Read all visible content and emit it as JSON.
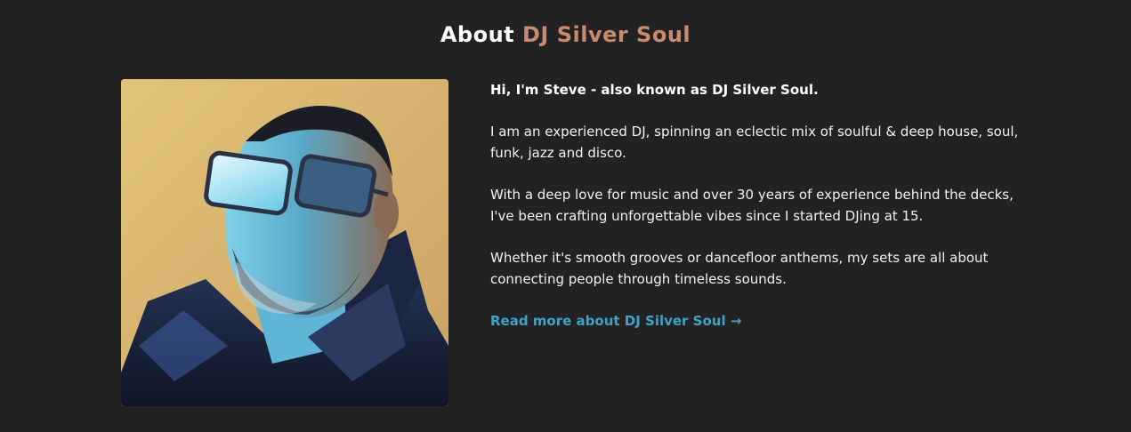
{
  "heading": {
    "prefix": "About",
    "accent": "DJ Silver Soul"
  },
  "photo": {
    "alt": "Portrait of DJ Silver Soul wearing reflective glasses and a leather jacket"
  },
  "about": {
    "intro": "Hi, I'm Steve - also known as DJ Silver Soul.",
    "paragraph_1": "I am an experienced DJ, spinning an eclectic mix of soulful & deep house, soul, funk, jazz and disco.",
    "paragraph_2": "With a deep love for music and over 30 years of experience behind the decks, I've been crafting unforgettable vibes since I started DJing at 15.",
    "paragraph_3": "Whether it's smooth grooves or dancefloor anthems, my sets are all about connecting people through timeless sounds.",
    "read_more": "Read more about DJ Silver Soul →"
  },
  "colors": {
    "background": "#222222",
    "accent": "#c98b6e",
    "link": "#3ea3c7"
  }
}
